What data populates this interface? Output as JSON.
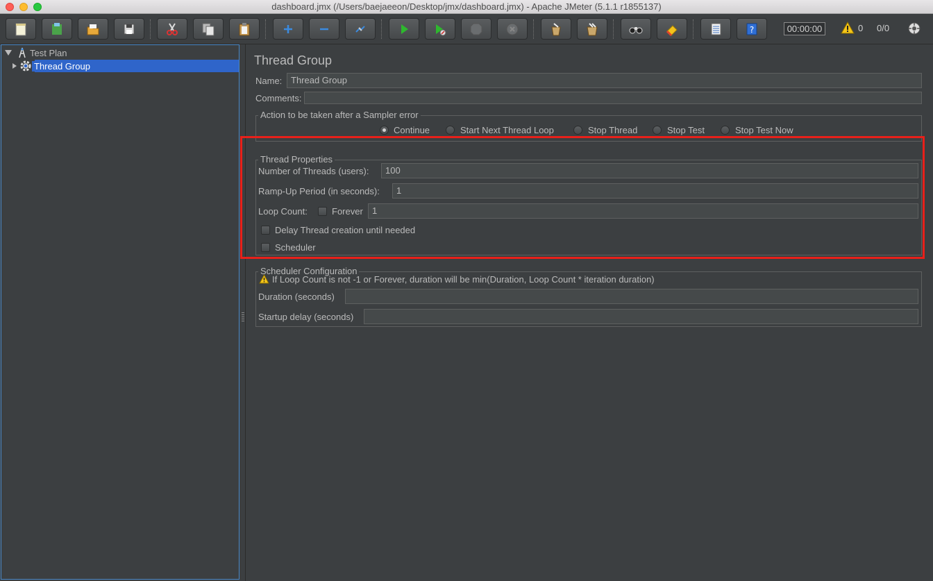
{
  "window": {
    "title": "dashboard.jmx (/Users/baejaeeon/Desktop/jmx/dashboard.jmx) - Apache JMeter (5.1.1 r1855137)"
  },
  "toolbar": {
    "buttons": [
      {
        "name": "new-icon"
      },
      {
        "name": "templates-icon"
      },
      {
        "name": "open-icon"
      },
      {
        "name": "save-icon"
      },
      {
        "name": "cut-icon"
      },
      {
        "name": "copy-icon"
      },
      {
        "name": "paste-icon"
      },
      {
        "name": "expand-icon"
      },
      {
        "name": "collapse-icon"
      },
      {
        "name": "toggle-icon"
      },
      {
        "name": "start-icon"
      },
      {
        "name": "start-no-pauses-icon"
      },
      {
        "name": "stop-icon"
      },
      {
        "name": "shutdown-icon"
      },
      {
        "name": "clear-icon"
      },
      {
        "name": "clear-all-icon"
      },
      {
        "name": "search-icon"
      },
      {
        "name": "reset-search-icon"
      },
      {
        "name": "function-helper-icon"
      },
      {
        "name": "help-icon"
      }
    ],
    "timer": "00:00:00",
    "warning_count": "0",
    "thread_ratio": "0/0"
  },
  "tree": {
    "items": [
      {
        "label": "Test Plan",
        "icon": "test-plan-icon",
        "expanded": true
      },
      {
        "label": "Thread Group",
        "icon": "gear-icon",
        "selected": true
      }
    ]
  },
  "main": {
    "title": "Thread Group",
    "name_label": "Name:",
    "name_value": "Thread Group",
    "comments_label": "Comments:",
    "comments_value": "",
    "sampler_error": {
      "legend": "Action to be taken after a Sampler error",
      "options": [
        {
          "label": "Continue",
          "selected": true
        },
        {
          "label": "Start Next Thread Loop",
          "selected": false
        },
        {
          "label": "Stop Thread",
          "selected": false
        },
        {
          "label": "Stop Test",
          "selected": false
        },
        {
          "label": "Stop Test Now",
          "selected": false
        }
      ]
    },
    "thread_properties": {
      "legend": "Thread Properties",
      "threads_label": "Number of Threads (users):",
      "threads_value": "100",
      "rampup_label": "Ramp-Up Period (in seconds):",
      "rampup_value": "1",
      "loop_label": "Loop Count:",
      "forever_label": "Forever",
      "forever_checked": false,
      "loop_value": "1",
      "delay_label": "Delay Thread creation until needed",
      "delay_checked": false,
      "scheduler_label": "Scheduler",
      "scheduler_checked": false
    },
    "scheduler_config": {
      "legend": "Scheduler Configuration",
      "warning": "If Loop Count is not -1 or Forever, duration will be min(Duration, Loop Count * iteration duration)",
      "duration_label": "Duration (seconds)",
      "duration_value": "",
      "startup_label": "Startup delay (seconds)",
      "startup_value": ""
    }
  },
  "colors": {
    "highlight": "#e8201a",
    "selection": "#2f65ca",
    "background": "#3c3f41"
  }
}
